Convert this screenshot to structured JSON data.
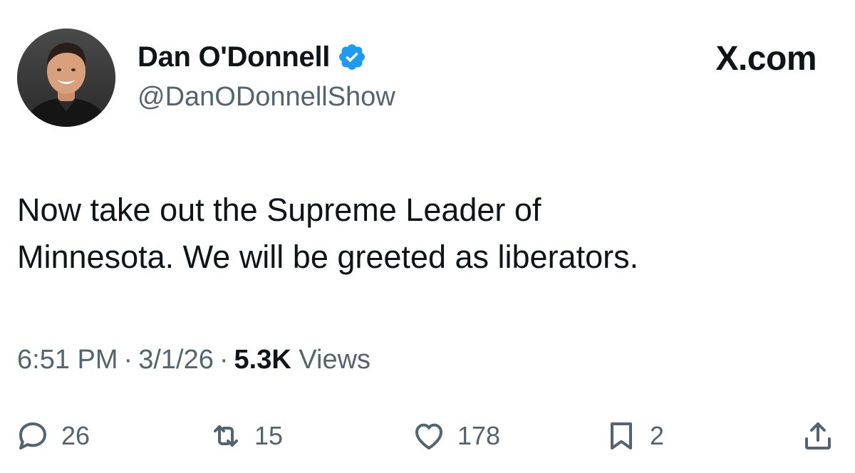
{
  "author": {
    "display_name": "Dan O'Donnell",
    "handle": "@DanODonnellShow",
    "verified": true
  },
  "brand": "X.com",
  "tweet": {
    "lines": [
      "Now take out the Supreme Leader of",
      "Minnesota. We will be greeted as liberators."
    ]
  },
  "meta": {
    "time": "6:51 PM",
    "separator": "·",
    "date": "3/1/26",
    "views_count": "5.3K",
    "views_label": "Views"
  },
  "actions": {
    "reply_count": "26",
    "retweet_count": "15",
    "like_count": "178",
    "bookmark_count": "2"
  },
  "icons": {
    "verified": "verified-badge-icon",
    "reply": "reply-icon",
    "retweet": "retweet-icon",
    "like": "heart-icon",
    "bookmark": "bookmark-icon",
    "share": "share-icon"
  },
  "colors": {
    "verified_blue": "#1d9bf0",
    "text_primary": "#0f1419",
    "text_secondary": "#536471"
  }
}
